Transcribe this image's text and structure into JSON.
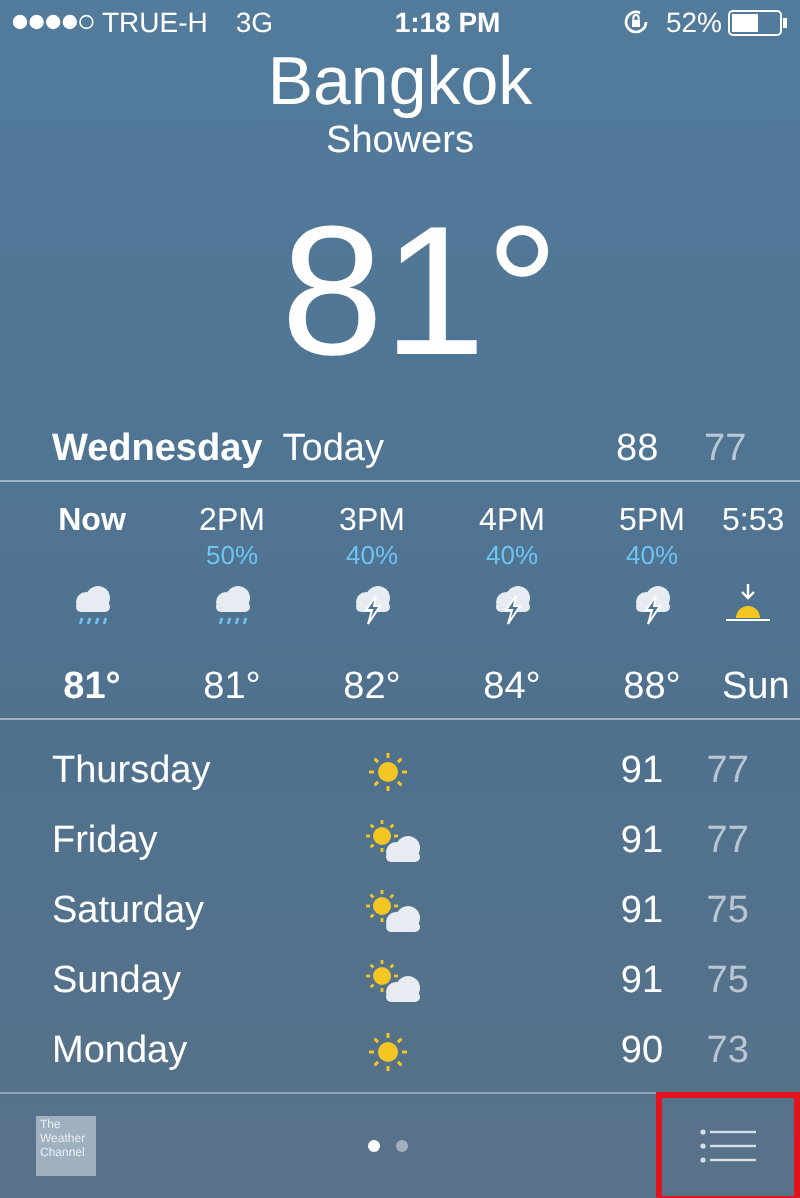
{
  "status_bar": {
    "carrier": "TRUE-H",
    "network": "3G",
    "time": "1:18 PM",
    "battery_percent": "52%"
  },
  "current": {
    "city": "Bangkok",
    "condition": "Showers",
    "temperature": "81°"
  },
  "today": {
    "day": "Wednesday",
    "label": "Today",
    "high": "88",
    "low": "77"
  },
  "hourly": [
    {
      "time": "Now",
      "kind": "rain",
      "temp": "81°",
      "now": true
    },
    {
      "time": "2PM",
      "chance": "50%",
      "kind": "rain",
      "temp": "81°",
      "now": false
    },
    {
      "time": "3PM",
      "chance": "40%",
      "kind": "thunder",
      "temp": "82°",
      "now": false
    },
    {
      "time": "4PM",
      "chance": "40%",
      "kind": "thunder",
      "temp": "84°",
      "now": false
    },
    {
      "time": "5PM",
      "chance": "40%",
      "kind": "thunder",
      "temp": "88°",
      "now": false
    },
    {
      "time": "5:53",
      "kind": "sunset",
      "temp": "Sun",
      "now": false
    }
  ],
  "daily": [
    {
      "day": "Thursday",
      "kind": "sunny",
      "high": "91",
      "low": "77"
    },
    {
      "day": "Friday",
      "kind": "partly-sunny",
      "high": "91",
      "low": "77"
    },
    {
      "day": "Saturday",
      "kind": "partly-sunny",
      "high": "91",
      "low": "75"
    },
    {
      "day": "Sunday",
      "kind": "partly-sunny",
      "high": "91",
      "low": "75"
    },
    {
      "day": "Monday",
      "kind": "sunny",
      "high": "90",
      "low": "73"
    }
  ],
  "footer": {
    "logo": "The Weather Channel",
    "pages": [
      {
        "selected": true
      },
      {
        "selected": false
      }
    ],
    "list_button": {
      "highlighted": true
    }
  }
}
